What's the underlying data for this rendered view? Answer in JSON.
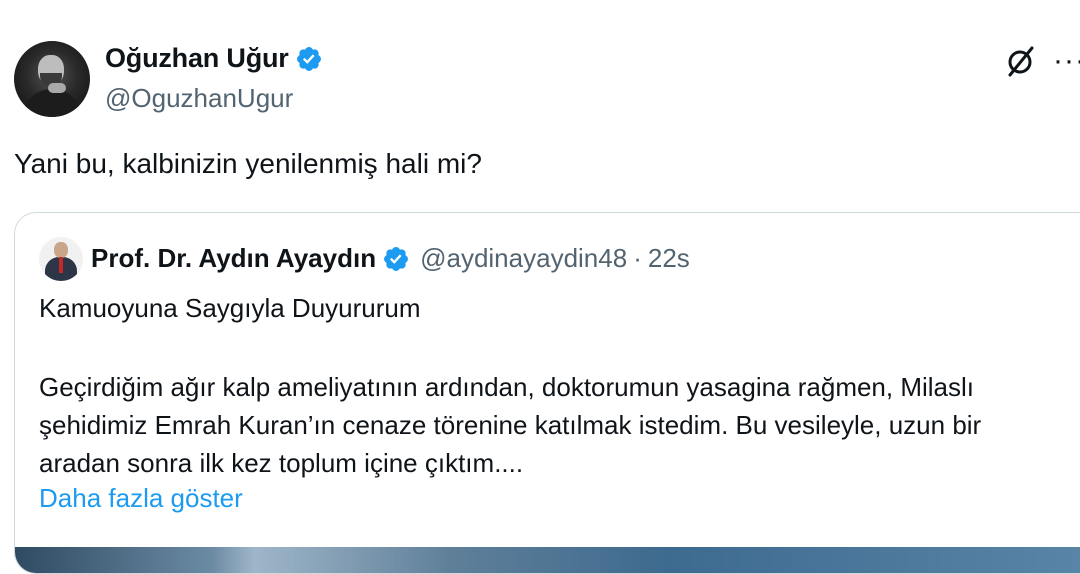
{
  "author": {
    "display_name": "Oğuzhan Uğur",
    "handle": "@OguzhanUgur",
    "verified": true,
    "avatar_icon": "profile-photo"
  },
  "actions": {
    "grok_icon": "grok-icon",
    "more_label": "···"
  },
  "tweet": {
    "text": "Yani bu, kalbinizin yenilenmiş hali mi?"
  },
  "quoted": {
    "display_name": "Prof. Dr. Aydın Ayaydın",
    "handle": "@aydinayaydin48",
    "separator": "·",
    "time": "22s",
    "verified": true,
    "title": "Kamuoyuna Saygıyla Duyururum",
    "body": "Geçirdiğim ağır kalp ameliyatının ardından, doktorumun yasagina rağmen, Milaslı şehidimiz Emrah Kuran’ın cenaze törenine katılmak istedim. Bu vesileyle, uzun bir aradan sonra ilk kez toplum içine çıktım....",
    "show_more": "Daha fazla göster"
  },
  "colors": {
    "accent": "#1d9bf0",
    "text": "#0f1419",
    "secondary": "#536471",
    "border": "#cfd9de"
  }
}
